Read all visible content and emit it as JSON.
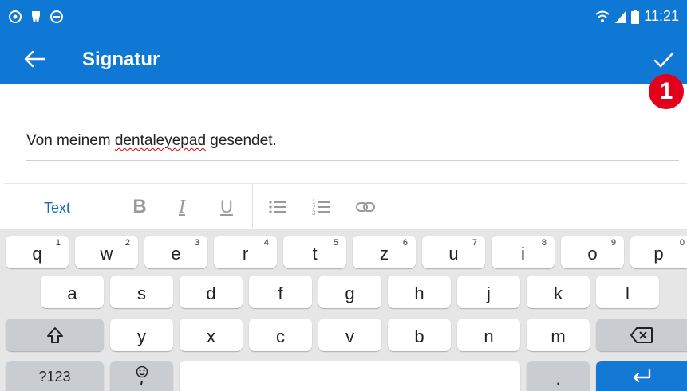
{
  "status_bar": {
    "time": "11:21"
  },
  "app_bar": {
    "title": "Signatur"
  },
  "badge": {
    "number": "1"
  },
  "signature": {
    "before": "Von meinem ",
    "misspelled": "dentaleyepad",
    "after": " gesendet."
  },
  "format_bar": {
    "text_tab": "Text"
  },
  "keyboard": {
    "row1": [
      {
        "label": "q",
        "sup": "1"
      },
      {
        "label": "w",
        "sup": "2"
      },
      {
        "label": "e",
        "sup": "3"
      },
      {
        "label": "r",
        "sup": "4"
      },
      {
        "label": "t",
        "sup": "5"
      },
      {
        "label": "z",
        "sup": "6"
      },
      {
        "label": "u",
        "sup": "7"
      },
      {
        "label": "i",
        "sup": "8"
      },
      {
        "label": "o",
        "sup": "9"
      },
      {
        "label": "p",
        "sup": "0"
      }
    ],
    "row2": [
      "a",
      "s",
      "d",
      "f",
      "g",
      "h",
      "j",
      "k",
      "l"
    ],
    "row3": [
      "y",
      "x",
      "c",
      "v",
      "b",
      "n",
      "m"
    ],
    "symbols_key": "?123",
    "period_key": "."
  },
  "colors": {
    "primary": "#0f78d4",
    "badge": "#e3001b",
    "enter": "#1479d4"
  }
}
